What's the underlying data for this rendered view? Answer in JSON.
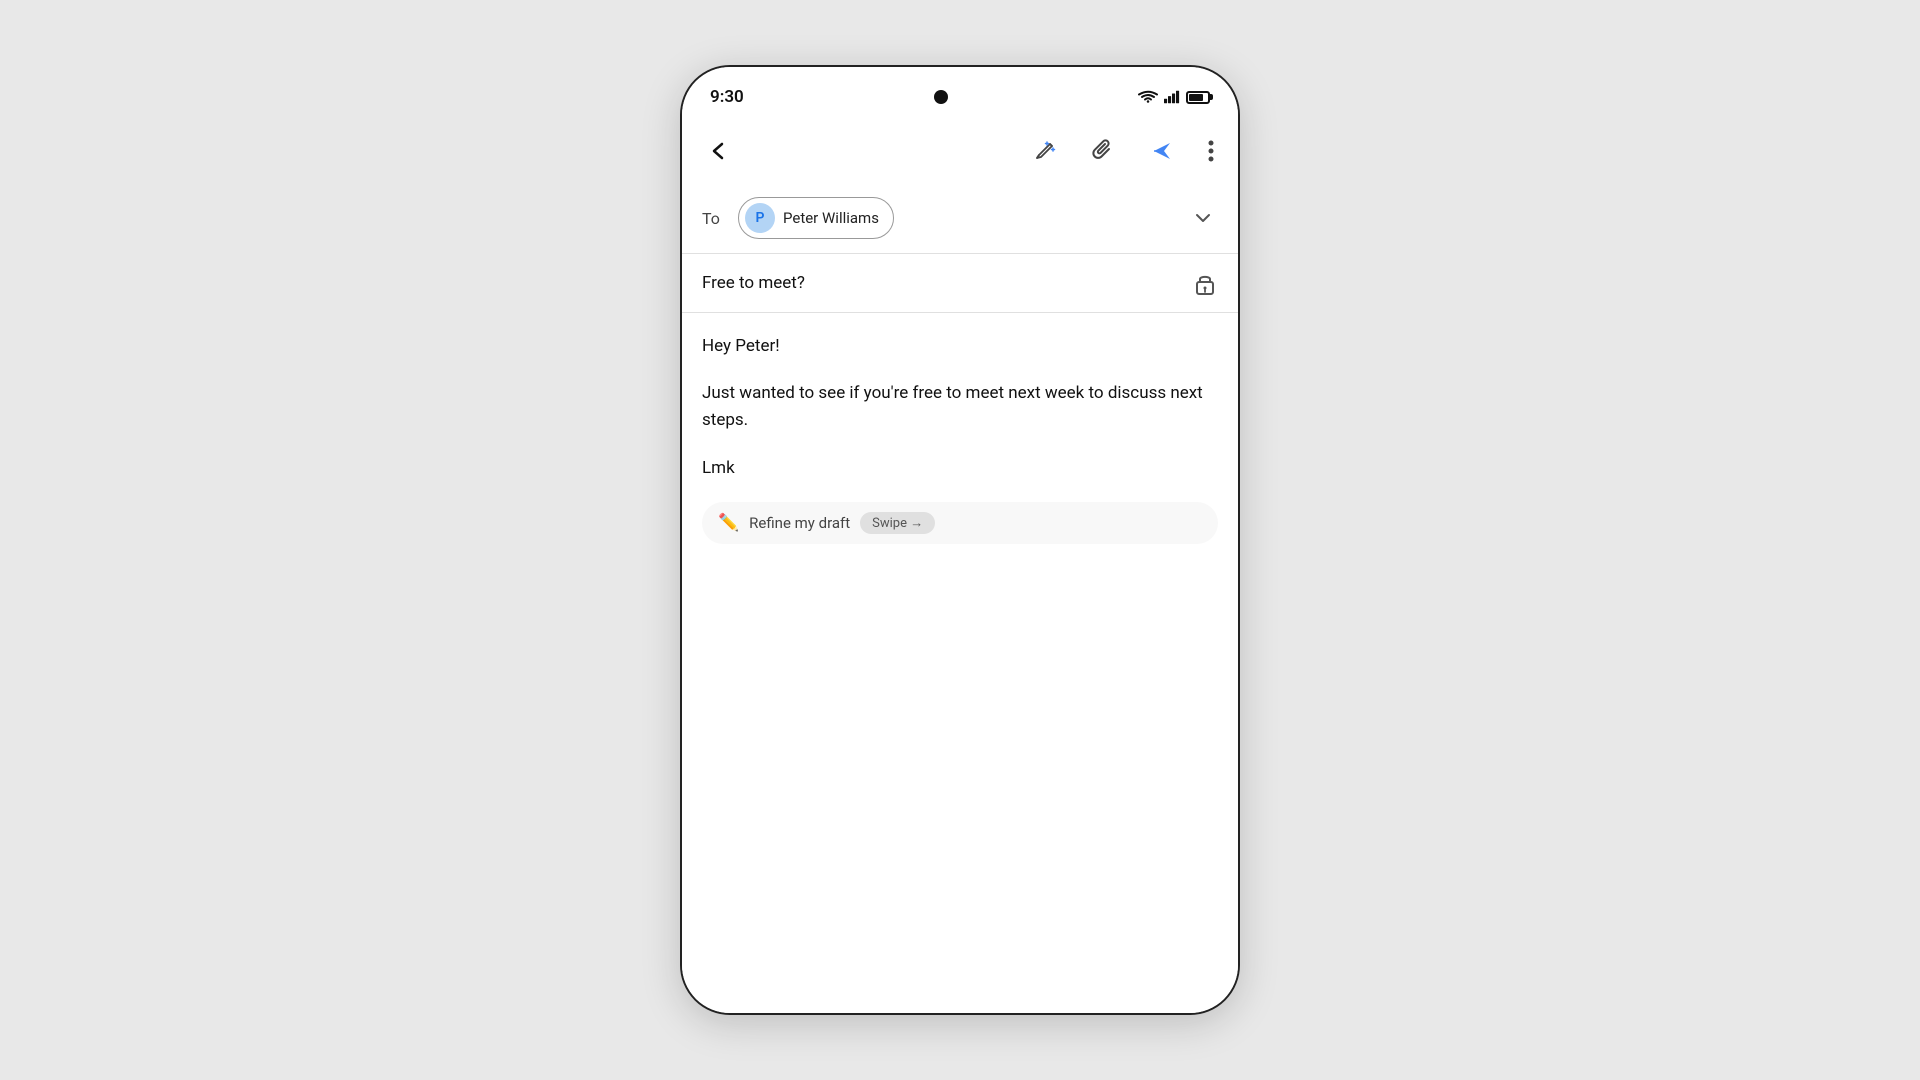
{
  "statusBar": {
    "time": "9:30"
  },
  "toolbar": {
    "backLabel": "back",
    "editIcon": "edit-icon",
    "attachIcon": "attach-icon",
    "sendIcon": "send-icon",
    "moreIcon": "more-icon"
  },
  "compose": {
    "toLabel": "To",
    "recipient": {
      "initial": "P",
      "name": "Peter Williams"
    },
    "subject": "Free to meet?",
    "bodyLines": [
      "Hey Peter!",
      "Just wanted to see if you're free to meet next week to discuss next steps.",
      "Lmk"
    ],
    "aiSuggestion": {
      "label": "Refine my draft",
      "swipeText": "Swipe →"
    }
  }
}
